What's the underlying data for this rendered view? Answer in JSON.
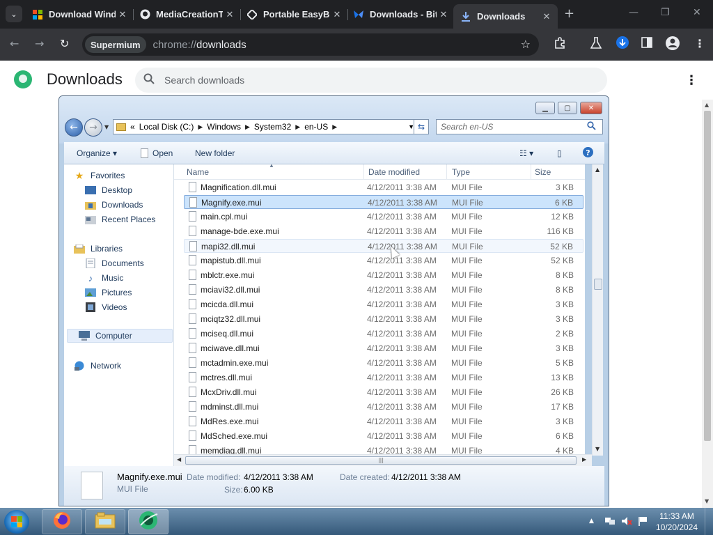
{
  "browser": {
    "tabs": [
      {
        "title": "Download Windows",
        "icon": "windows-logo-icon",
        "active": false
      },
      {
        "title": "MediaCreationTool",
        "icon": "github-icon",
        "active": false
      },
      {
        "title": "Portable EasyBCD",
        "icon": "diamond-icon",
        "active": false
      },
      {
        "title": "Downloads - Bit",
        "icon": "butterfly-icon",
        "active": false
      },
      {
        "title": "Downloads",
        "icon": "download-icon",
        "active": true
      }
    ],
    "omnibox": {
      "chip": "Supermium",
      "scheme": "chrome://",
      "path": "downloads"
    }
  },
  "downloads_page": {
    "title": "Downloads",
    "search_placeholder": "Search downloads"
  },
  "explorer": {
    "breadcrumb": [
      "«",
      "Local Disk (C:)",
      "Windows",
      "System32",
      "en-US"
    ],
    "search_placeholder": "Search en-US",
    "commands": {
      "organize": "Organize",
      "open": "Open",
      "new_folder": "New folder"
    },
    "nav": {
      "favorites": "Favorites",
      "desktop": "Desktop",
      "downloads": "Downloads",
      "recent": "Recent Places",
      "libraries": "Libraries",
      "documents": "Documents",
      "music": "Music",
      "pictures": "Pictures",
      "videos": "Videos",
      "computer": "Computer",
      "network": "Network"
    },
    "columns": {
      "name": "Name",
      "date": "Date modified",
      "type": "Type",
      "size": "Size"
    },
    "files": [
      {
        "name": "Magnification.dll.mui",
        "date": "4/12/2011 3:38 AM",
        "type": "MUI File",
        "size": "3 KB"
      },
      {
        "name": "Magnify.exe.mui",
        "date": "4/12/2011 3:38 AM",
        "type": "MUI File",
        "size": "6 KB"
      },
      {
        "name": "main.cpl.mui",
        "date": "4/12/2011 3:38 AM",
        "type": "MUI File",
        "size": "12 KB"
      },
      {
        "name": "manage-bde.exe.mui",
        "date": "4/12/2011 3:38 AM",
        "type": "MUI File",
        "size": "116 KB"
      },
      {
        "name": "mapi32.dll.mui",
        "date": "4/12/2011 3:38 AM",
        "type": "MUI File",
        "size": "52 KB"
      },
      {
        "name": "mapistub.dll.mui",
        "date": "4/12/2011 3:38 AM",
        "type": "MUI File",
        "size": "52 KB"
      },
      {
        "name": "mblctr.exe.mui",
        "date": "4/12/2011 3:38 AM",
        "type": "MUI File",
        "size": "8 KB"
      },
      {
        "name": "mciavi32.dll.mui",
        "date": "4/12/2011 3:38 AM",
        "type": "MUI File",
        "size": "8 KB"
      },
      {
        "name": "mcicda.dll.mui",
        "date": "4/12/2011 3:38 AM",
        "type": "MUI File",
        "size": "3 KB"
      },
      {
        "name": "mciqtz32.dll.mui",
        "date": "4/12/2011 3:38 AM",
        "type": "MUI File",
        "size": "3 KB"
      },
      {
        "name": "mciseq.dll.mui",
        "date": "4/12/2011 3:38 AM",
        "type": "MUI File",
        "size": "2 KB"
      },
      {
        "name": "mciwave.dll.mui",
        "date": "4/12/2011 3:38 AM",
        "type": "MUI File",
        "size": "3 KB"
      },
      {
        "name": "mctadmin.exe.mui",
        "date": "4/12/2011 3:38 AM",
        "type": "MUI File",
        "size": "5 KB"
      },
      {
        "name": "mctres.dll.mui",
        "date": "4/12/2011 3:38 AM",
        "type": "MUI File",
        "size": "13 KB"
      },
      {
        "name": "McxDriv.dll.mui",
        "date": "4/12/2011 3:38 AM",
        "type": "MUI File",
        "size": "26 KB"
      },
      {
        "name": "mdminst.dll.mui",
        "date": "4/12/2011 3:38 AM",
        "type": "MUI File",
        "size": "17 KB"
      },
      {
        "name": "MdRes.exe.mui",
        "date": "4/12/2011 3:38 AM",
        "type": "MUI File",
        "size": "3 KB"
      },
      {
        "name": "MdSched.exe.mui",
        "date": "4/12/2011 3:38 AM",
        "type": "MUI File",
        "size": "6 KB"
      },
      {
        "name": "memdiag.dll.mui",
        "date": "4/12/2011 3:38 AM",
        "type": "MUI File",
        "size": "4 KB"
      }
    ],
    "selected_index": 1,
    "hover_index": 4,
    "details": {
      "name": "Magnify.exe.mui",
      "type": "MUI File",
      "date_modified_label": "Date modified:",
      "date_modified": "4/12/2011 3:38 AM",
      "date_created_label": "Date created:",
      "date_created": "4/12/2011 3:38 AM",
      "size_label": "Size:",
      "size": "6.00 KB"
    }
  },
  "taskbar": {
    "clock_time": "11:33 AM",
    "clock_date": "10/20/2024"
  },
  "colors": {
    "chrome_dark": "#202124",
    "chrome_tab": "#35363a",
    "selection": "#cce4fc",
    "accent_green": "#2bb673"
  }
}
